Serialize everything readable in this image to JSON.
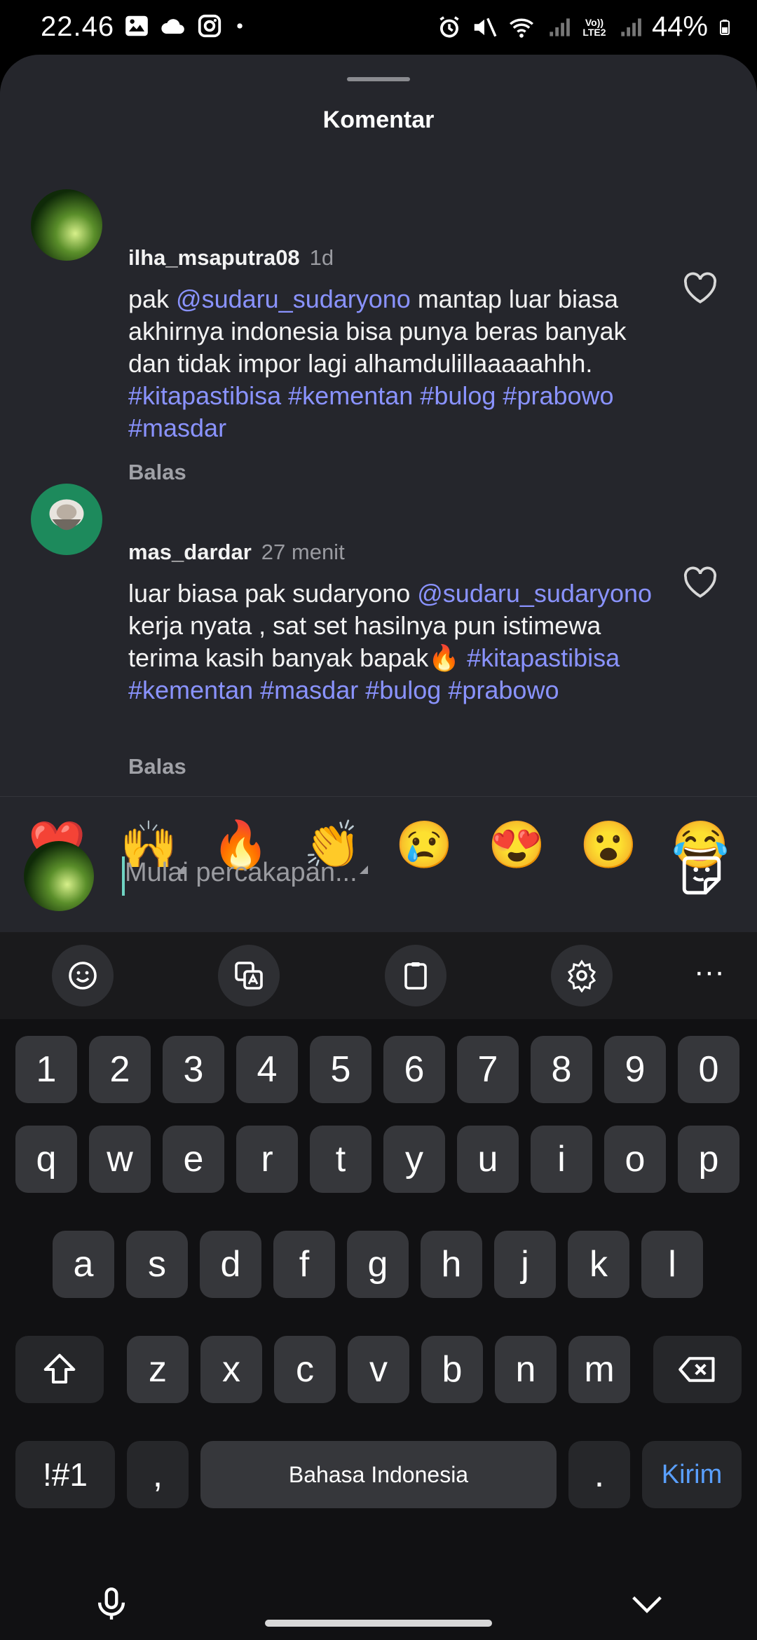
{
  "status_bar": {
    "time": "22.46",
    "battery": "44%",
    "network_label": "Vo)) LTE2"
  },
  "sheet": {
    "title": "Komentar"
  },
  "comments": [
    {
      "username": "ilha_msaputra08",
      "time": "1d",
      "text_parts": [
        "pak ",
        "@sudaru_sudaryono",
        " mantap luar biasa akhirnya indonesia bisa punya beras banyak dan tidak impor lagi alhamdulillaaaaahhh. ",
        "#kitapastibisa",
        " ",
        "#kementan",
        " ",
        "#bulog",
        " ",
        "#prabowo",
        " ",
        "#masdar"
      ],
      "reply_label": "Balas"
    },
    {
      "username": "mas_dardar",
      "time": "27 menit",
      "text_parts": [
        "luar biasa pak sudaryono ",
        "@sudaru_sudaryono",
        "  kerja nyata , sat set hasilnya pun istimewa terima kasih banyak bapak🔥 ",
        "#kitapastibisa",
        " ",
        "#kementan",
        " ",
        "#masdar",
        " ",
        "#bulog",
        " ",
        "#prabowo"
      ],
      "reply_label": "Balas"
    }
  ],
  "quick_emojis": [
    "❤️",
    "🙌",
    "🔥",
    "👏",
    "😢",
    "😍",
    "😮",
    "😂"
  ],
  "composer": {
    "placeholder": "Mulai percakapan..."
  },
  "keyboard": {
    "row_numbers": [
      "1",
      "2",
      "3",
      "4",
      "5",
      "6",
      "7",
      "8",
      "9",
      "0"
    ],
    "row_top": [
      "q",
      "w",
      "e",
      "r",
      "t",
      "y",
      "u",
      "i",
      "o",
      "p"
    ],
    "row_middle": [
      "a",
      "s",
      "d",
      "f",
      "g",
      "h",
      "j",
      "k",
      "l"
    ],
    "row_bottom": [
      "z",
      "x",
      "c",
      "v",
      "b",
      "n",
      "m"
    ],
    "symbols_label": "!#1",
    "comma_label": ",",
    "space_label": "Bahasa Indonesia",
    "period_label": ".",
    "send_label": "Kirim"
  },
  "icons": {
    "heart": "heart-outline-icon",
    "sticker": "sticker-icon",
    "mic": "mic-icon",
    "hide": "chevron-down-icon"
  },
  "colors": {
    "sheet_bg": "#25262c",
    "mention": "#8a93ff",
    "send": "#5aa0ff"
  }
}
